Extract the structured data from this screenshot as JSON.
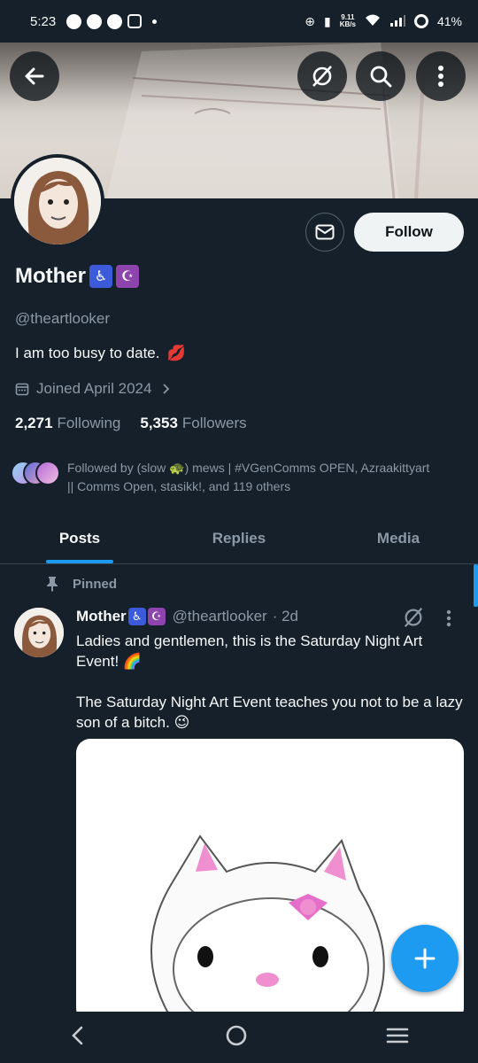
{
  "status_bar": {
    "time": "5:23",
    "speed": "9.11",
    "speed_unit": "KB/s",
    "battery": "41%"
  },
  "profile": {
    "name": "Mother",
    "name_emoji_1": "♿",
    "name_emoji_2": "☪",
    "handle": "@theartlooker",
    "bio": "I am too busy to date.",
    "bio_emoji": "💋",
    "joined": "Joined April 2024",
    "following_count": "2,271",
    "following_label": "Following",
    "followers_count": "5,353",
    "followers_label": "Followers",
    "followed_by": "Followed by (slow 🐢) mews | #VGenComms OPEN, Azraakittyart || Comms Open, stasikk!, and 119 others",
    "follow_label": "Follow"
  },
  "tabs": [
    {
      "label": "Posts",
      "active": true
    },
    {
      "label": "Replies",
      "active": false
    },
    {
      "label": "Media",
      "active": false
    }
  ],
  "tweet": {
    "pinned_label": "Pinned",
    "author": "Mother",
    "handle": "@theartlooker",
    "time": "· 2d",
    "text_1": "Ladies and gentlemen, this is the Saturday Night Art Event! 🌈",
    "text_2": "The Saturday Night Art Event teaches you not to be a lazy son of a bitch. 😉"
  },
  "colors": {
    "background": "#15202b",
    "accent": "#1d9bf0",
    "secondary_text": "#8b98a5",
    "emoji_box_1": "#3b5bdb",
    "emoji_box_2": "#8e44ad"
  }
}
